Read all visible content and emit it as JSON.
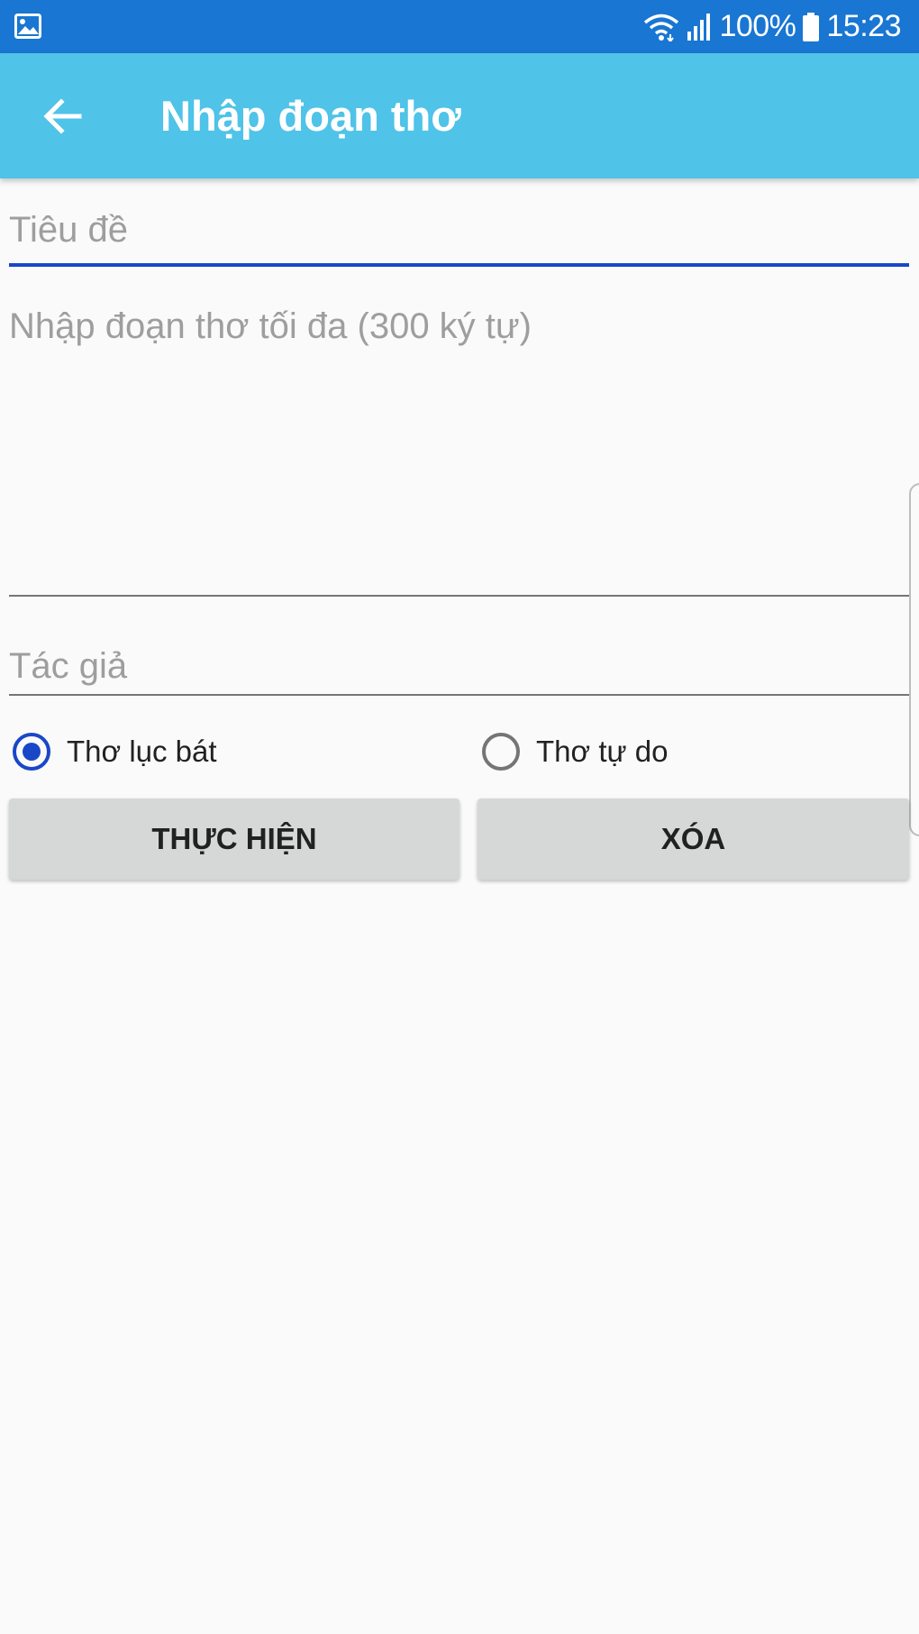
{
  "status_bar": {
    "gallery_icon": "image-icon",
    "wifi_icon": "wifi-icon",
    "signal_icon": "signal-icon",
    "battery_text": "100%",
    "battery_icon": "battery-icon",
    "time": "15:23",
    "background_color": "#1976d2"
  },
  "app_bar": {
    "back_icon": "arrow-back-icon",
    "title": "Nhập đoạn thơ",
    "background_color": "#4fc3e8"
  },
  "form": {
    "title_field": {
      "placeholder": "Tiêu đề",
      "value": ""
    },
    "content_field": {
      "placeholder": "Nhập đoạn thơ tối đa (300 ký tự)",
      "value": ""
    },
    "author_field": {
      "placeholder": "Tác giả",
      "value": ""
    },
    "poem_type": {
      "options": [
        {
          "label": "Thơ lục bát",
          "checked": true
        },
        {
          "label": "Thơ tự do",
          "checked": false
        }
      ]
    },
    "buttons": {
      "submit_label": "THỰC HIỆN",
      "clear_label": "XÓA"
    },
    "accent_color": "#1a47c7"
  }
}
